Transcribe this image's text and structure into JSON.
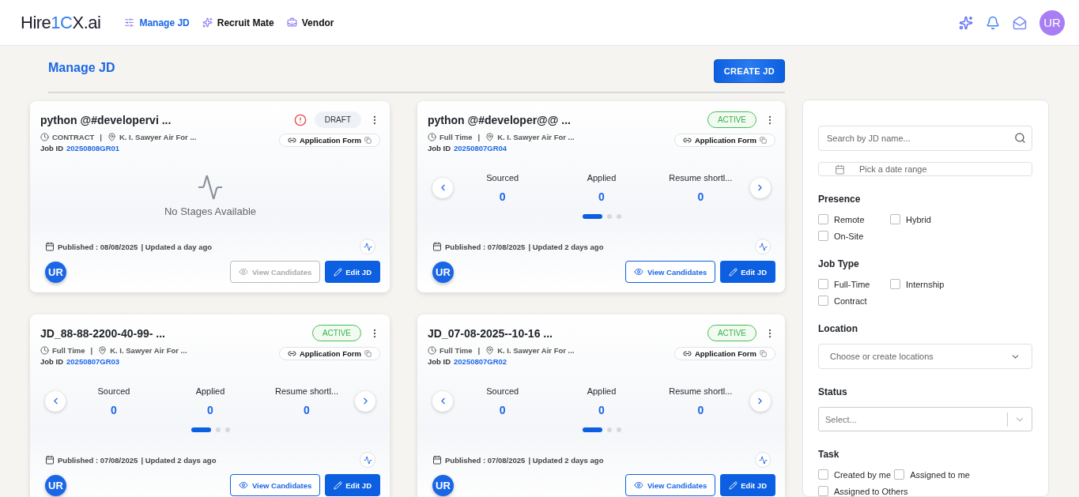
{
  "header": {
    "logo": {
      "before": "Hire",
      "mark": "1C",
      "after": "X.ai"
    },
    "nav": [
      {
        "label": "Manage JD",
        "selected": true
      },
      {
        "label": "Recruit Mate",
        "selected": false
      },
      {
        "label": "Vendor",
        "selected": false
      }
    ],
    "avatar": "UR"
  },
  "page": {
    "title": "Manage JD",
    "create_button": "CREATE JD"
  },
  "cards": [
    {
      "title": "python @#developervi ...",
      "alert": true,
      "status": {
        "kind": "draft",
        "label": "DRAFT"
      },
      "job_type": "CONTRACT",
      "separator": "|",
      "location": "K. I. Sawyer Air For ...",
      "job_id_label": "Job ID",
      "job_id": "20250808GR01",
      "form_link": "Application Form",
      "empty_message": "No Stages Available",
      "published": "Published : 08/08/2025",
      "updated": "| Updated a day ago",
      "avatar": "UR",
      "view_button": {
        "label": "View Candidates",
        "disabled": true
      },
      "edit_button": "Edit JD"
    },
    {
      "title": "python @#developer@@ ...",
      "alert": false,
      "status": {
        "kind": "active",
        "label": "ACTIVE"
      },
      "job_type": "Full Time",
      "separator": "|",
      "location": "K. I. Sawyer Air For ...",
      "job_id_label": "Job ID",
      "job_id": "20250807GR04",
      "form_link": "Application Form",
      "stages": [
        {
          "label": "Sourced",
          "count": "0"
        },
        {
          "label": "Applied",
          "count": "0"
        },
        {
          "label": "Resume shortl...",
          "count": "0"
        }
      ],
      "dots": [
        {
          "selected": true
        },
        {
          "selected": false
        },
        {
          "selected": false
        }
      ],
      "published": "Published : 07/08/2025",
      "updated": "| Updated 2 days ago",
      "avatar": "UR",
      "view_button": {
        "label": "View Candidates",
        "disabled": false
      },
      "edit_button": "Edit JD"
    },
    {
      "title": "JD_88-88-2200-40-99- ...",
      "alert": false,
      "status": {
        "kind": "active",
        "label": "ACTIVE"
      },
      "job_type": "Full Time",
      "separator": "|",
      "location": "K. I. Sawyer Air For ...",
      "job_id_label": "Job ID",
      "job_id": "20250807GR03",
      "form_link": "Application Form",
      "stages": [
        {
          "label": "Sourced",
          "count": "0"
        },
        {
          "label": "Applied",
          "count": "0"
        },
        {
          "label": "Resume shortl...",
          "count": "0"
        }
      ],
      "dots": [
        {
          "selected": true
        },
        {
          "selected": false
        },
        {
          "selected": false
        }
      ],
      "published": "Published : 07/08/2025",
      "updated": "| Updated 2 days ago",
      "avatar": "UR",
      "view_button": {
        "label": "View Candidates",
        "disabled": false
      },
      "edit_button": "Edit JD"
    },
    {
      "title": "JD_07-08-2025--10-16 ...",
      "alert": false,
      "status": {
        "kind": "active",
        "label": "ACTIVE"
      },
      "job_type": "Full Time",
      "separator": "|",
      "location": "K. I. Sawyer Air For ...",
      "job_id_label": "Job ID",
      "job_id": "20250807GR02",
      "form_link": "Application Form",
      "stages": [
        {
          "label": "Sourced",
          "count": "0"
        },
        {
          "label": "Applied",
          "count": "0"
        },
        {
          "label": "Resume shortl...",
          "count": "0"
        }
      ],
      "dots": [
        {
          "selected": true
        },
        {
          "selected": false
        },
        {
          "selected": false
        }
      ],
      "published": "Published : 07/08/2025",
      "updated": "| Updated 2 days ago",
      "avatar": "UR",
      "view_button": {
        "label": "View Candidates",
        "disabled": false
      },
      "edit_button": "Edit JD"
    }
  ],
  "filters": {
    "search": {
      "placeholder": "Search by JD name..."
    },
    "date": {
      "placeholder": "Pick a date range"
    },
    "sections": [
      {
        "kind": "checkboxes",
        "title": "Presence",
        "options": [
          {
            "label": "Remote",
            "checked": false
          },
          {
            "label": "Hybrid",
            "checked": false
          },
          {
            "label": "On-Site",
            "checked": false
          }
        ]
      },
      {
        "kind": "checkboxes",
        "title": "Job Type",
        "options": [
          {
            "label": "Full-Time",
            "checked": false
          },
          {
            "label": "Internship",
            "checked": false
          },
          {
            "label": "Contract",
            "checked": false
          }
        ]
      },
      {
        "kind": "dropdown",
        "title": "Location",
        "placeholder": "Choose or create locations"
      },
      {
        "kind": "select",
        "title": "Status",
        "placeholder": "Select..."
      },
      {
        "kind": "checkboxes",
        "title": "Task",
        "options": [
          {
            "label": "Created by me",
            "checked": false
          },
          {
            "label": "Assigned to me",
            "checked": false
          },
          {
            "label": "Assigned to Others",
            "checked": false
          }
        ]
      }
    ]
  }
}
